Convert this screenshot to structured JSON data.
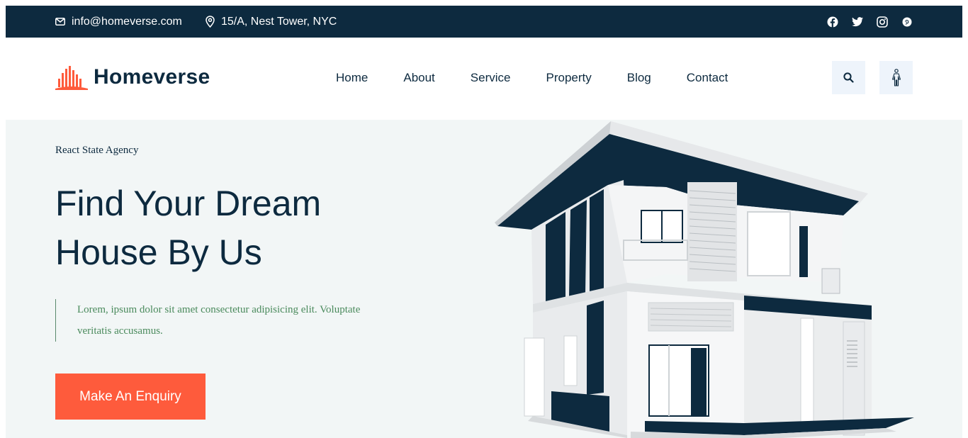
{
  "topbar": {
    "email": "info@homeverse.com",
    "address": "15/A, Nest Tower, NYC",
    "socials": [
      "facebook-icon",
      "twitter-icon",
      "instagram-icon",
      "pinterest-icon"
    ]
  },
  "header": {
    "logo_text": "Homeverse",
    "nav": [
      "Home",
      "About",
      "Service",
      "Property",
      "Blog",
      "Contact"
    ]
  },
  "hero": {
    "subtitle": "React State Agency",
    "title": "Find Your Dream House By Us",
    "description": "Lorem, ipsum dolor sit amet consectetur adipisicing elit. Voluptate veritatis accusamus.",
    "cta": "Make An Enquiry"
  },
  "colors": {
    "navy": "#0d2a3f",
    "accent": "#fe5b3c",
    "hero_bg": "#f2f6f6",
    "button_bg": "#eef4fb",
    "desc_green": "#4a8a5c"
  }
}
